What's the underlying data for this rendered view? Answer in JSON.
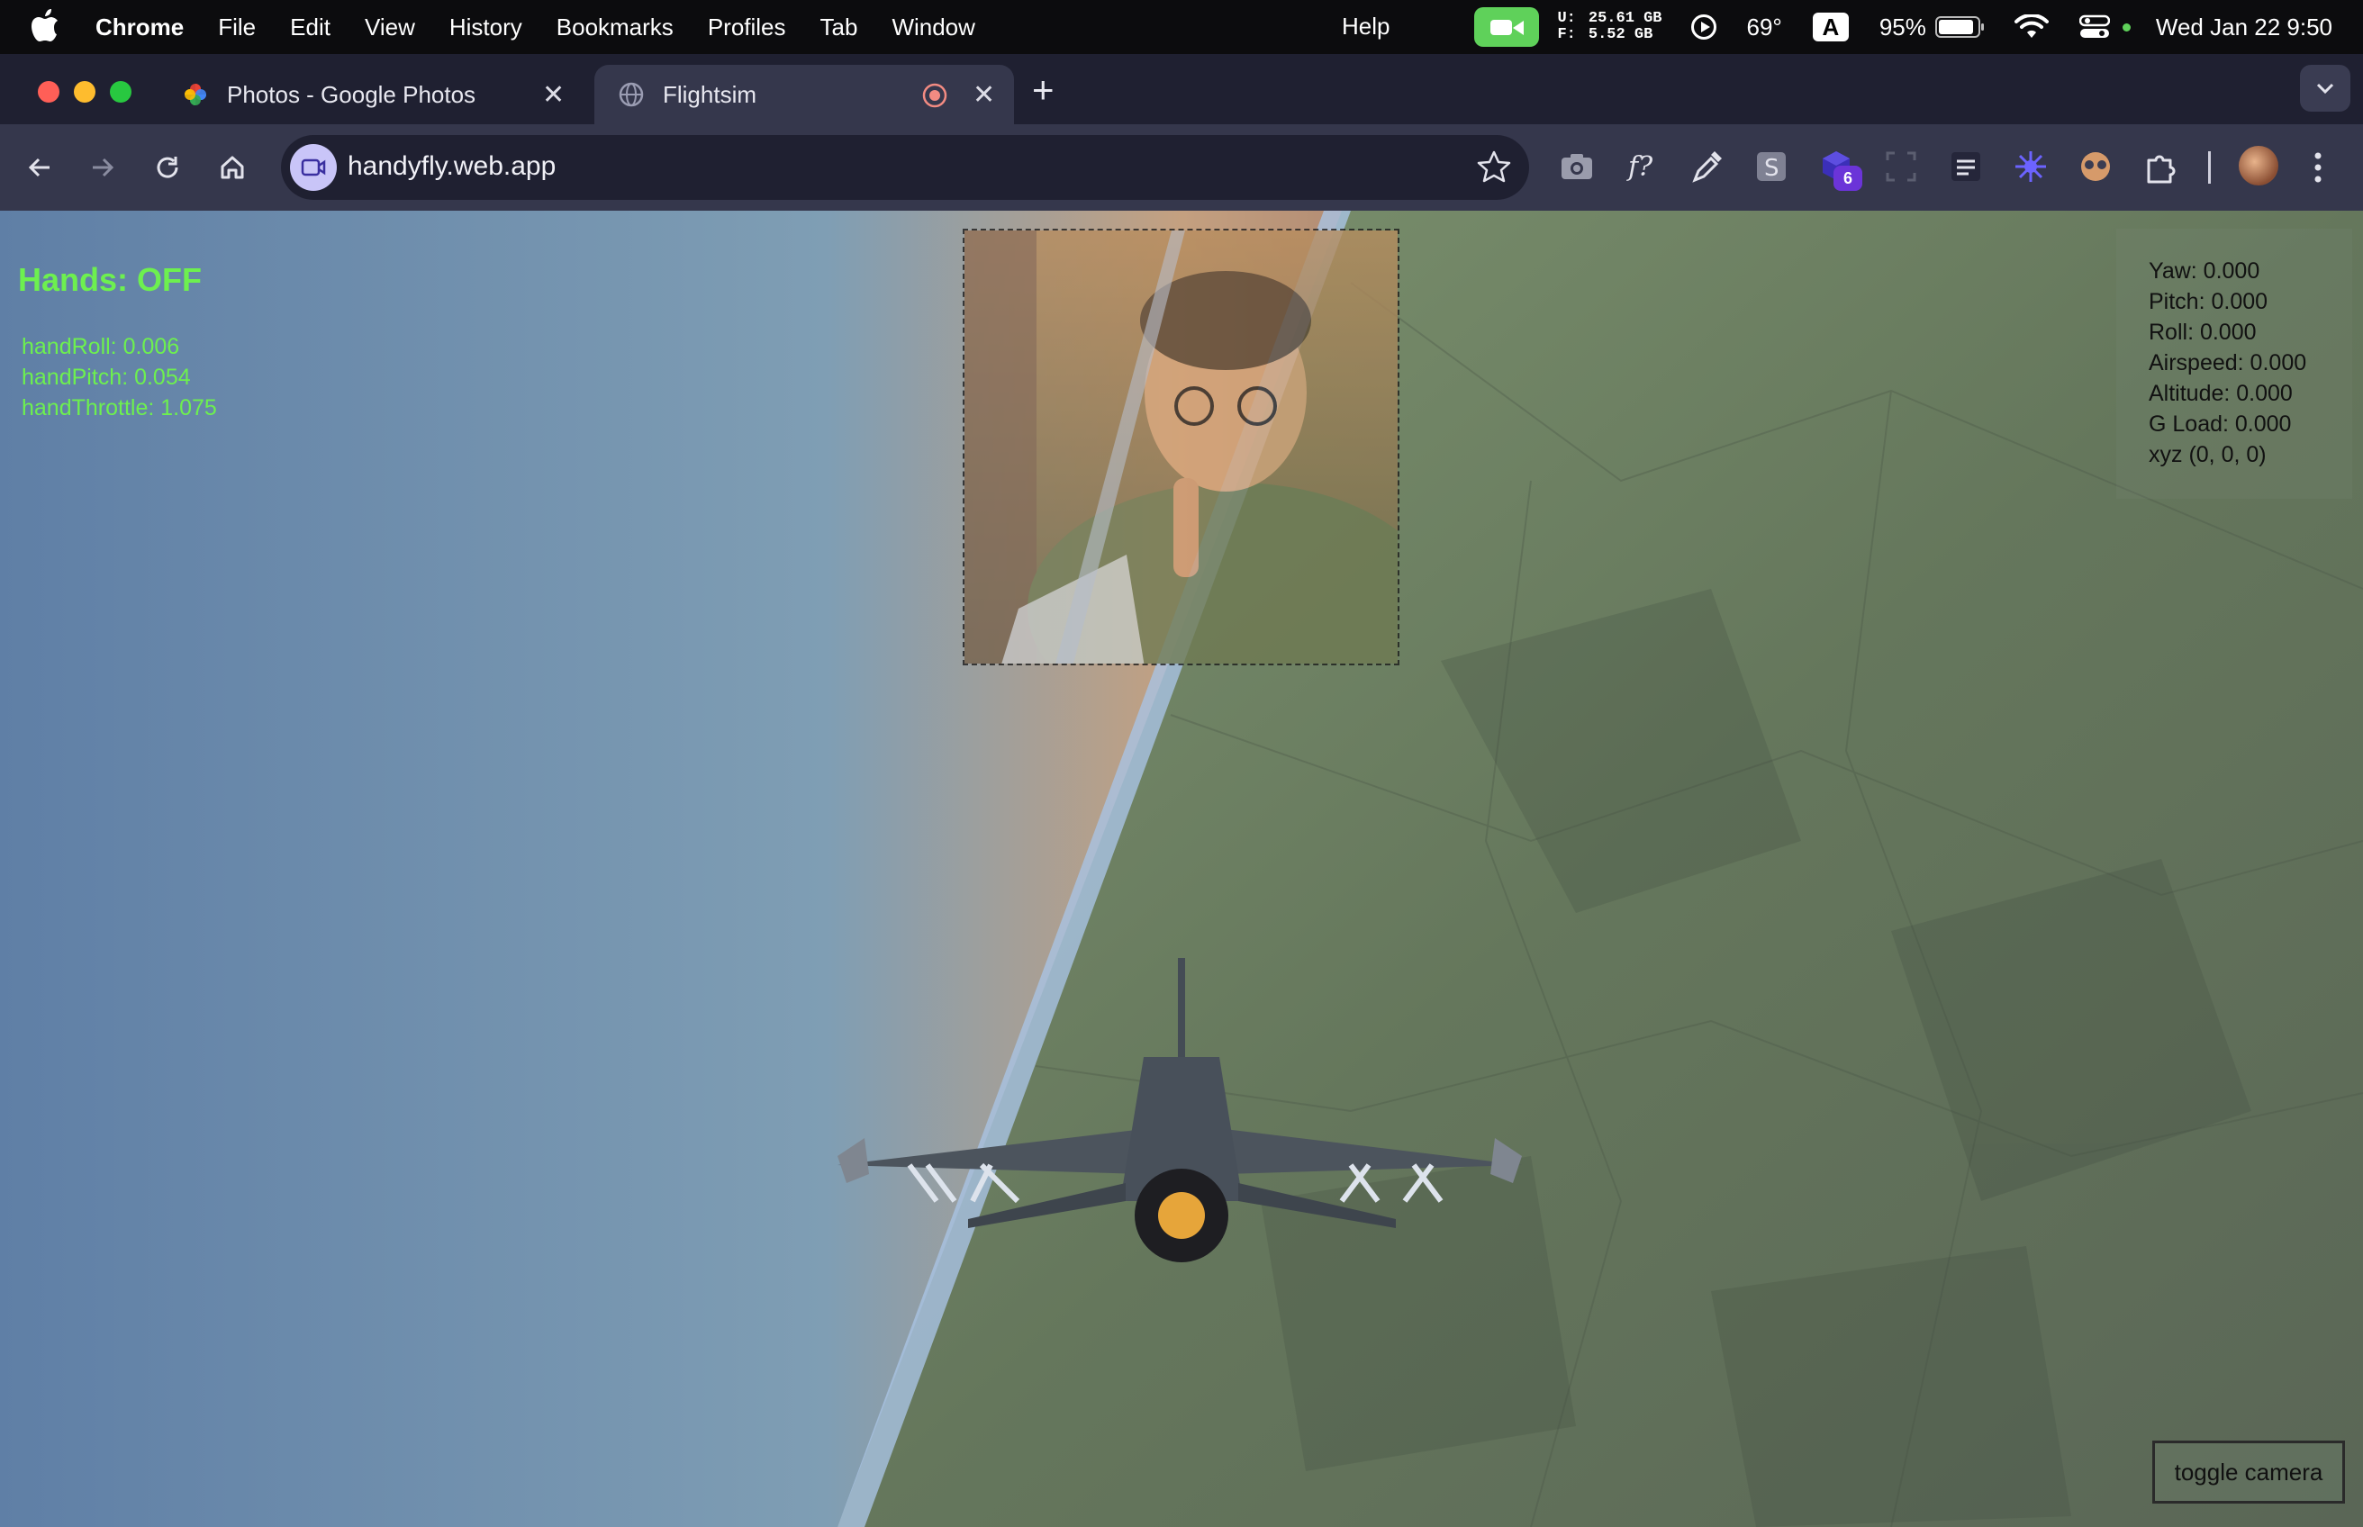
{
  "menubar": {
    "app_name": "Chrome",
    "menus": [
      "File",
      "Edit",
      "View",
      "History",
      "Bookmarks",
      "Profiles",
      "Tab",
      "Window"
    ],
    "help": "Help",
    "disk_used_label": "U:",
    "disk_used": "25.61 GB",
    "disk_free_label": "F:",
    "disk_free": "5.52 GB",
    "temperature": "69°",
    "input_source": "A",
    "battery": "95%",
    "datetime": "Wed Jan 22  9:50",
    "colors": {
      "facetime": "#5fd15a"
    }
  },
  "tabs": [
    {
      "title": "Photos - Google Photos",
      "icon": "google-photos-icon",
      "active": false
    },
    {
      "title": "Flightsim",
      "icon": "globe-icon",
      "active": true,
      "recording": true
    }
  ],
  "toolbar": {
    "url": "handyfly.web.app",
    "extension_badge": "6"
  },
  "page": {
    "hands_status": "Hands: OFF",
    "hand_metrics": {
      "roll": "handRoll: 0.006",
      "pitch": "handPitch: 0.054",
      "throttle": "handThrottle: 1.075"
    },
    "flight": {
      "yaw": "Yaw: 0.000",
      "pitch": "Pitch: 0.000",
      "roll": "Roll: 0.000",
      "airspeed": "Airspeed: 0.000",
      "altitude": "Altitude: 0.000",
      "g_load": "G Load: 0.000",
      "xyz": "xyz (0, 0, 0)"
    },
    "toggle_camera": "toggle camera",
    "colors": {
      "hud_green": "#6df04f",
      "sky": "#6a8bb0",
      "terrain": "#5f6b58"
    }
  }
}
